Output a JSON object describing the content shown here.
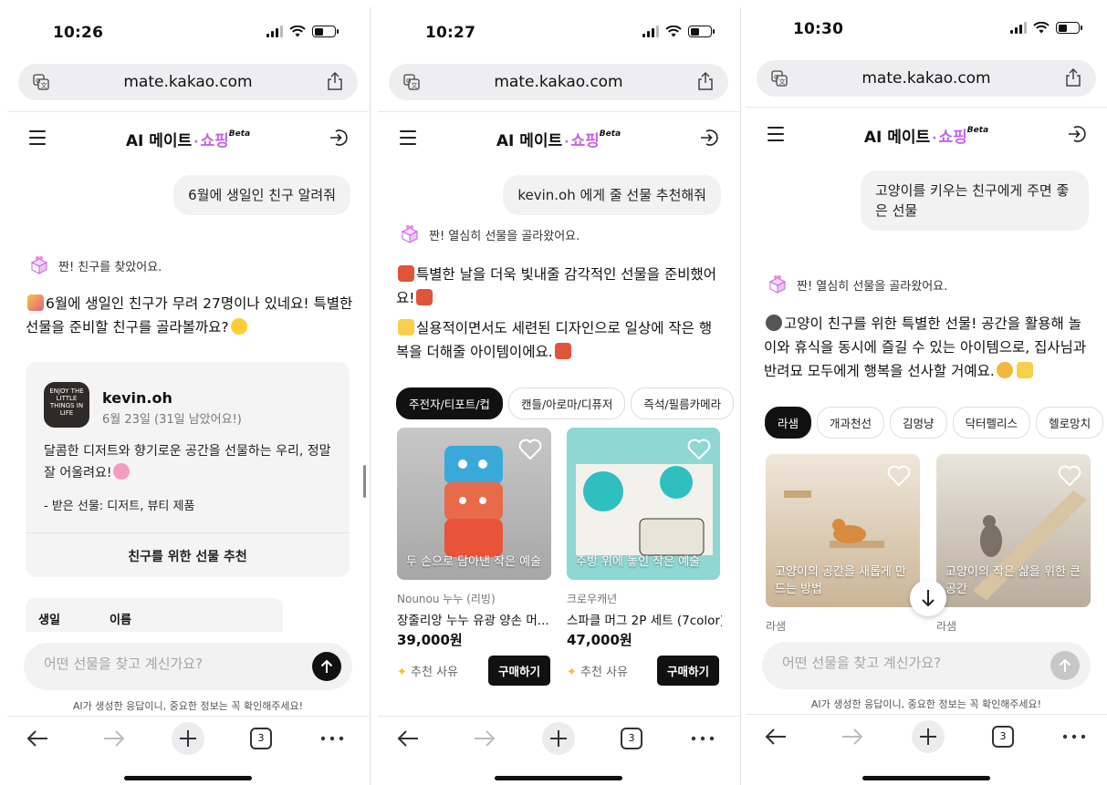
{
  "common": {
    "url": "mate.kakao.com",
    "app_title_prefix": "AI 메이트",
    "app_title_sep": "·",
    "app_title_suffix": "쇼핑",
    "beta": "Beta",
    "disclaimer": "AI가 생성한 응답이니, 중요한 정보는 꼭 확인해주세요!",
    "input_placeholder": "어떤 선물을 찾고 계신가요?",
    "tab_count": "3",
    "accent": "#c264e6"
  },
  "screen1": {
    "time": "10:26",
    "user_message": "6월에 생일인 친구 알려줘",
    "status": "짠! 친구를 찾았어요.",
    "reply": "6월에 생일인 친구가 무려 27명이나 있네요! 특별한 선물을 준비할 친구를 골라볼까요?",
    "card": {
      "book_cover": "ENJOY THE LITTLE THINGS IN LIFE",
      "name": "kevin.oh",
      "date": "6월 23일 (31일 남았어요!)",
      "desc": "달콤한 디저트와 향기로운 공간을 선물하는 우리, 정말 잘 어울려요!",
      "gifts": "- 받은 선물: 디저트, 뷰티 제품",
      "button": "친구를 위한 선물 추천"
    },
    "table_headers": [
      "생일",
      "이름"
    ]
  },
  "screen2": {
    "time": "10:27",
    "user_message": "kevin.oh 에게 줄 선물 추천해줘",
    "status": "짠! 열심히 선물을 골라왔어요.",
    "reply1": "특별한 날을 더욱 빛내줄 감각적인 선물을 준비했어요!",
    "reply2": "실용적이면서도 세련된 디자인으로 일상에 작은 행복을 더해줄 아이템이에요.",
    "chips": [
      "주전자/티포트/컵",
      "캔들/아로마/디퓨저",
      "즉석/필름카메라"
    ],
    "products": [
      {
        "caption": "두 손으로 담아낸 작은 예술",
        "brand": "Nounou 누누 (리빙)",
        "name": "장줄리앙 누누 유광 양손 머...",
        "price": "39,000원",
        "reason": "추천 사유",
        "buy": "구매하기"
      },
      {
        "caption": "주방 위에 놓인 작은 예술",
        "brand": "크로우캐년",
        "name": "스파클 머그 2P 세트 (7color)",
        "price": "47,000원",
        "reason": "추천 사유",
        "buy": "구매하기"
      }
    ]
  },
  "screen3": {
    "time": "10:30",
    "user_message_line1": "고양이를 키우는 친구에게 주면 좋",
    "user_message_line2": "은 선물",
    "status": "짠! 열심히 선물을 골라왔어요.",
    "reply": "고양이 친구를 위한 특별한 선물! 공간을 활용해 놀이와 휴식을 동시에 즐길 수 있는 아이템으로, 집사님과 반려묘 모두에게 행복을 선사할 거예요.",
    "chips": [
      "라샘",
      "개과천선",
      "김멍냥",
      "닥터펠리스",
      "헬로망치"
    ],
    "products": [
      {
        "caption": "고양이의 공간을 새롭게 만드는 방법",
        "brand": "라샘"
      },
      {
        "caption": "고양이의 작은 삶을 위한 큰 공간",
        "brand": "라샘"
      }
    ]
  }
}
